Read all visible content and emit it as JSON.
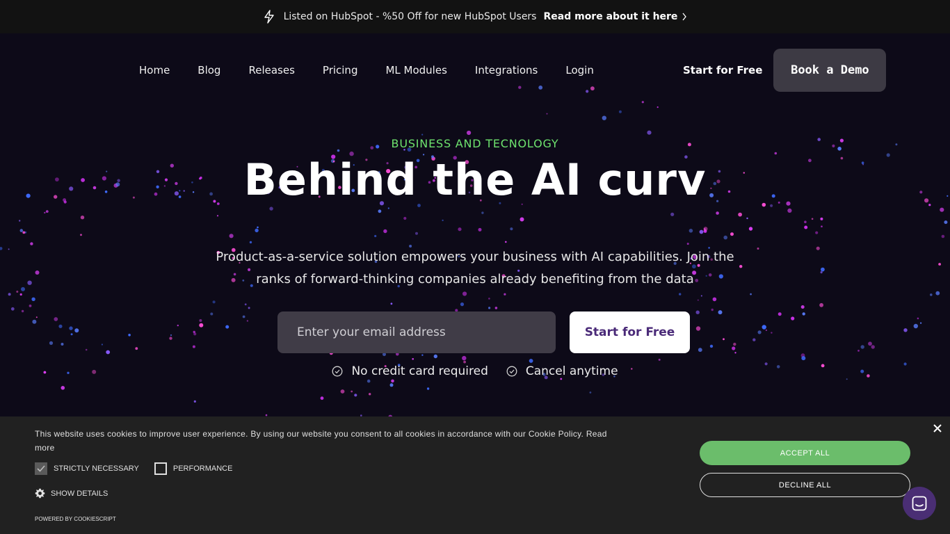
{
  "announcement": {
    "text": "Listed on HubSpot - %50 Off for new HubSpot Users",
    "link": "Read more about it here"
  },
  "nav": {
    "links": [
      "Home",
      "Blog",
      "Releases",
      "Pricing",
      "ML Modules",
      "Integrations",
      "Login"
    ],
    "start_free": "Start for Free",
    "book_demo": "Book a Demo"
  },
  "hero": {
    "eyebrow": "BUSINESS AND TECNOLOGY",
    "headline": "Behind the AI curv",
    "subtitle": "Product-as-a-service solution empowers your business with AI capabilities. Join the ranks of forward-thinking companies already benefiting from the data",
    "email_placeholder": "Enter your email address",
    "cta": "Start for Free",
    "perks": [
      "No credit card required",
      "Cancel anytime"
    ]
  },
  "cookie": {
    "text": "This website uses cookies to improve user experience. By using our website you consent to all cookies in accordance with our Cookie Policy. Read more",
    "options": [
      {
        "label": "STRICTLY NECESSARY",
        "checked": true
      },
      {
        "label": "PERFORMANCE",
        "checked": false
      }
    ],
    "show_details": "SHOW DETAILS",
    "powered_by": "POWERED BY COOKIESCRIPT",
    "accept": "ACCEPT ALL",
    "decline": "DECLINE ALL"
  },
  "colors": {
    "accent_green": "#6ee36e",
    "cta_purple": "#4a2a78",
    "background": "#0d0a18"
  }
}
